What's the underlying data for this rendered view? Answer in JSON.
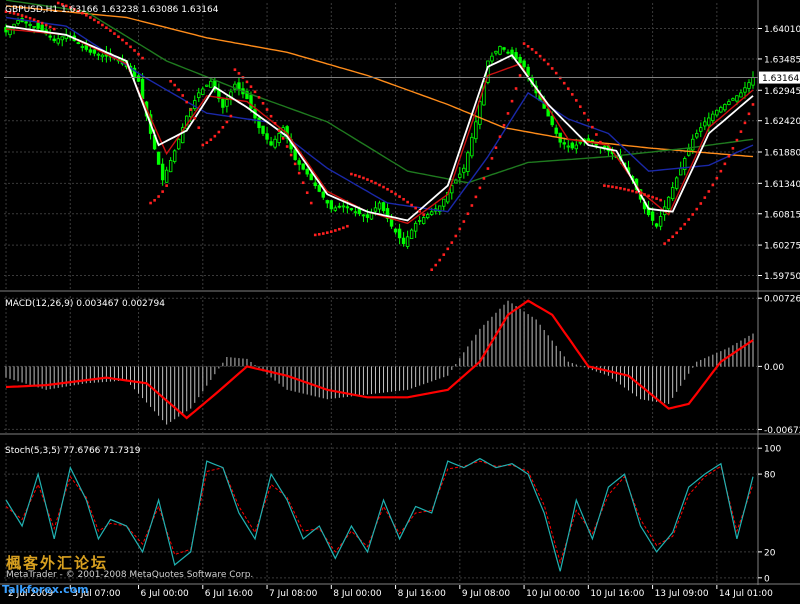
{
  "chart_data": [
    {
      "type": "candlestick",
      "title": "GBPUSD,H1  1.63166 1.63238 1.63086 1.63164",
      "ylim": [
        1.595,
        1.6445
      ],
      "y_ticks": [
        "1.64010",
        "1.63485",
        "1.62945",
        "1.62420",
        "1.61880",
        "1.61340",
        "1.60815",
        "1.60275",
        "1.59750"
      ],
      "y_tick_values": [
        1.6401,
        1.63485,
        1.62945,
        1.6242,
        1.6188,
        1.6134,
        1.60815,
        1.60275,
        1.5975
      ],
      "current_price_label": "1.63164",
      "current_price": 1.63164,
      "x_labels": [
        "2 Jul 2009",
        "3 Jul 07:00",
        "6 Jul 00:00",
        "6 Jul 16:00",
        "7 Jul 08:00",
        "8 Jul 00:00",
        "8 Jul 16:00",
        "9 Jul 08:00",
        "10 Jul 00:00",
        "10 Jul 16:00",
        "13 Jul 09:00",
        "14 Jul 01:00"
      ],
      "x_label_bars": [
        0,
        16,
        33,
        49,
        65,
        81,
        97,
        113,
        129,
        145,
        161,
        177
      ],
      "bar_count": 187,
      "close_anchors": [
        [
          0,
          1.6395
        ],
        [
          3,
          1.6415
        ],
        [
          6,
          1.6408
        ],
        [
          9,
          1.6398
        ],
        [
          12,
          1.638
        ],
        [
          15,
          1.639
        ],
        [
          18,
          1.6375
        ],
        [
          21,
          1.636
        ],
        [
          24,
          1.6355
        ],
        [
          27,
          1.635
        ],
        [
          30,
          1.6335
        ],
        [
          33,
          1.631
        ],
        [
          36,
          1.622
        ],
        [
          39,
          1.614
        ],
        [
          42,
          1.619
        ],
        [
          45,
          1.625
        ],
        [
          48,
          1.629
        ],
        [
          51,
          1.631
        ],
        [
          54,
          1.6265
        ],
        [
          57,
          1.6305
        ],
        [
          60,
          1.628
        ],
        [
          63,
          1.623
        ],
        [
          66,
          1.62
        ],
        [
          69,
          1.623
        ],
        [
          72,
          1.6175
        ],
        [
          75,
          1.615
        ],
        [
          78,
          1.612
        ],
        [
          81,
          1.609
        ],
        [
          84,
          1.6095
        ],
        [
          87,
          1.6085
        ],
        [
          90,
          1.6075
        ],
        [
          93,
          1.61
        ],
        [
          96,
          1.606
        ],
        [
          99,
          1.603
        ],
        [
          102,
          1.6065
        ],
        [
          105,
          1.608
        ],
        [
          108,
          1.6095
        ],
        [
          111,
          1.613
        ],
        [
          114,
          1.616
        ],
        [
          117,
          1.624
        ],
        [
          120,
          1.6345
        ],
        [
          123,
          1.637
        ],
        [
          126,
          1.6355
        ],
        [
          129,
          1.6335
        ],
        [
          132,
          1.629
        ],
        [
          135,
          1.625
        ],
        [
          138,
          1.6205
        ],
        [
          141,
          1.6195
        ],
        [
          144,
          1.621
        ],
        [
          147,
          1.62
        ],
        [
          150,
          1.619
        ],
        [
          153,
          1.6175
        ],
        [
          156,
          1.614
        ],
        [
          159,
          1.609
        ],
        [
          162,
          1.606
        ],
        [
          165,
          1.611
        ],
        [
          168,
          1.616
        ],
        [
          171,
          1.621
        ],
        [
          174,
          1.624
        ],
        [
          177,
          1.626
        ],
        [
          180,
          1.6275
        ],
        [
          183,
          1.629
        ],
        [
          186,
          1.63164
        ]
      ],
      "moving_averages": [
        {
          "color": "#ff8c1a",
          "anchors": [
            [
              0,
              1.644
            ],
            [
              30,
              1.642
            ],
            [
              50,
              1.6385
            ],
            [
              70,
              1.636
            ],
            [
              90,
              1.632
            ],
            [
              110,
              1.627
            ],
            [
              124,
              1.623
            ],
            [
              140,
              1.621
            ],
            [
              160,
              1.6195
            ],
            [
              186,
              1.618
            ]
          ]
        },
        {
          "color": "#1f7a1f",
          "anchors": [
            [
              0,
              1.645
            ],
            [
              20,
              1.643
            ],
            [
              40,
              1.6345
            ],
            [
              60,
              1.629
            ],
            [
              80,
              1.624
            ],
            [
              100,
              1.6155
            ],
            [
              115,
              1.6135
            ],
            [
              130,
              1.617
            ],
            [
              150,
              1.618
            ],
            [
              170,
              1.6195
            ],
            [
              186,
              1.621
            ]
          ]
        },
        {
          "color": "#1a28a8",
          "anchors": [
            [
              0,
              1.642
            ],
            [
              15,
              1.6405
            ],
            [
              35,
              1.6315
            ],
            [
              50,
              1.6255
            ],
            [
              65,
              1.624
            ],
            [
              80,
              1.616
            ],
            [
              95,
              1.61
            ],
            [
              110,
              1.6085
            ],
            [
              120,
              1.618
            ],
            [
              130,
              1.629
            ],
            [
              140,
              1.6245
            ],
            [
              150,
              1.622
            ],
            [
              160,
              1.6155
            ],
            [
              175,
              1.6165
            ],
            [
              186,
              1.62
            ]
          ]
        },
        {
          "color": "#cc1111",
          "anchors": [
            [
              0,
              1.64
            ],
            [
              15,
              1.639
            ],
            [
              30,
              1.634
            ],
            [
              40,
              1.6185
            ],
            [
              50,
              1.6285
            ],
            [
              60,
              1.6275
            ],
            [
              70,
              1.622
            ],
            [
              80,
              1.612
            ],
            [
              90,
              1.6085
            ],
            [
              100,
              1.6065
            ],
            [
              110,
              1.6115
            ],
            [
              120,
              1.632
            ],
            [
              128,
              1.634
            ],
            [
              140,
              1.621
            ],
            [
              150,
              1.62
            ],
            [
              158,
              1.612
            ],
            [
              165,
              1.608
            ],
            [
              175,
              1.623
            ],
            [
              186,
              1.6295
            ]
          ]
        },
        {
          "color": "#ffffff",
          "anchors": [
            [
              0,
              1.6405
            ],
            [
              15,
              1.639
            ],
            [
              30,
              1.6345
            ],
            [
              38,
              1.62
            ],
            [
              45,
              1.6225
            ],
            [
              52,
              1.63
            ],
            [
              60,
              1.6265
            ],
            [
              70,
              1.6215
            ],
            [
              80,
              1.6115
            ],
            [
              90,
              1.6085
            ],
            [
              100,
              1.607
            ],
            [
              110,
              1.613
            ],
            [
              120,
              1.6335
            ],
            [
              126,
              1.6355
            ],
            [
              135,
              1.627
            ],
            [
              145,
              1.62
            ],
            [
              152,
              1.619
            ],
            [
              160,
              1.609
            ],
            [
              166,
              1.6085
            ],
            [
              175,
              1.622
            ],
            [
              186,
              1.6285
            ]
          ]
        }
      ],
      "parabolic_sar_segments": [
        {
          "from": 0,
          "to": 12,
          "start": 1.643,
          "end": 1.64
        },
        {
          "from": 13,
          "to": 34,
          "start": 1.6445,
          "end": 1.635
        },
        {
          "from": 36,
          "to": 40,
          "start": 1.61,
          "end": 1.613
        },
        {
          "from": 41,
          "to": 48,
          "start": 1.631,
          "end": 1.623
        },
        {
          "from": 49,
          "to": 56,
          "start": 1.62,
          "end": 1.625
        },
        {
          "from": 57,
          "to": 76,
          "start": 1.633,
          "end": 1.61
        },
        {
          "from": 77,
          "to": 85,
          "start": 1.6045,
          "end": 1.606
        },
        {
          "from": 86,
          "to": 104,
          "start": 1.615,
          "end": 1.608
        },
        {
          "from": 106,
          "to": 128,
          "start": 1.5985,
          "end": 1.632
        },
        {
          "from": 129,
          "to": 148,
          "start": 1.6375,
          "end": 1.6205
        },
        {
          "from": 149,
          "to": 163,
          "start": 1.613,
          "end": 1.6105
        },
        {
          "from": 164,
          "to": 186,
          "start": 1.603,
          "end": 1.627
        }
      ],
      "colors": {
        "up_bar": "#00ff00",
        "down_bar": "#00ff00",
        "grid": "#3a3a3a",
        "sar": "#ff2020"
      }
    },
    {
      "type": "macd",
      "title": "MACD(12,26,9) 0.003467 0.002794",
      "ylim": [
        -0.0071,
        0.0075
      ],
      "y_ticks": [
        "0.007266",
        "0.00",
        "-0.00672"
      ],
      "y_tick_values": [
        0.007266,
        0.0,
        -0.00672
      ],
      "histogram_anchors": [
        [
          0,
          -0.0012
        ],
        [
          10,
          -0.0025
        ],
        [
          20,
          -0.0018
        ],
        [
          30,
          -0.0015
        ],
        [
          40,
          -0.0062
        ],
        [
          46,
          -0.0045
        ],
        [
          55,
          0.001
        ],
        [
          60,
          0.0008
        ],
        [
          70,
          -0.0025
        ],
        [
          80,
          -0.0035
        ],
        [
          90,
          -0.003
        ],
        [
          100,
          -0.0025
        ],
        [
          110,
          -0.001
        ],
        [
          118,
          0.004
        ],
        [
          125,
          0.007
        ],
        [
          132,
          0.005
        ],
        [
          140,
          0.0005
        ],
        [
          150,
          -0.001
        ],
        [
          158,
          -0.0035
        ],
        [
          165,
          -0.004
        ],
        [
          172,
          0.0005
        ],
        [
          180,
          0.002
        ],
        [
          186,
          0.0035
        ]
      ],
      "signal_anchors": [
        [
          0,
          -0.0022
        ],
        [
          10,
          -0.002
        ],
        [
          25,
          -0.0012
        ],
        [
          35,
          -0.0018
        ],
        [
          45,
          -0.0055
        ],
        [
          52,
          -0.003
        ],
        [
          60,
          0.0
        ],
        [
          70,
          -0.001
        ],
        [
          80,
          -0.0025
        ],
        [
          90,
          -0.0033
        ],
        [
          100,
          -0.0033
        ],
        [
          110,
          -0.0025
        ],
        [
          118,
          0.0005
        ],
        [
          125,
          0.0055
        ],
        [
          130,
          0.007
        ],
        [
          136,
          0.0055
        ],
        [
          145,
          0.0
        ],
        [
          155,
          -0.001
        ],
        [
          165,
          -0.0045
        ],
        [
          170,
          -0.004
        ],
        [
          178,
          0.0005
        ],
        [
          186,
          0.0028
        ]
      ],
      "colors": {
        "histogram": "#c0c0c0",
        "signal": "#ff0000"
      }
    },
    {
      "type": "stochastic",
      "title": "Stoch(5,3,5) 77.6766 71.7319",
      "ylim": [
        0,
        100
      ],
      "y_ticks": [
        "100",
        "80",
        "20",
        "0"
      ],
      "y_tick_values": [
        100,
        80,
        20,
        0
      ],
      "main_anchors": [
        [
          0,
          60
        ],
        [
          4,
          40
        ],
        [
          8,
          80
        ],
        [
          12,
          30
        ],
        [
          16,
          85
        ],
        [
          20,
          60
        ],
        [
          23,
          30
        ],
        [
          26,
          45
        ],
        [
          30,
          40
        ],
        [
          34,
          20
        ],
        [
          38,
          60
        ],
        [
          42,
          10
        ],
        [
          46,
          20
        ],
        [
          50,
          90
        ],
        [
          54,
          85
        ],
        [
          58,
          50
        ],
        [
          62,
          30
        ],
        [
          66,
          80
        ],
        [
          70,
          60
        ],
        [
          74,
          30
        ],
        [
          78,
          40
        ],
        [
          82,
          15
        ],
        [
          86,
          40
        ],
        [
          90,
          20
        ],
        [
          94,
          60
        ],
        [
          98,
          30
        ],
        [
          102,
          55
        ],
        [
          106,
          50
        ],
        [
          110,
          90
        ],
        [
          114,
          85
        ],
        [
          118,
          92
        ],
        [
          122,
          85
        ],
        [
          126,
          88
        ],
        [
          130,
          80
        ],
        [
          134,
          50
        ],
        [
          138,
          5
        ],
        [
          142,
          60
        ],
        [
          146,
          30
        ],
        [
          150,
          70
        ],
        [
          154,
          80
        ],
        [
          158,
          40
        ],
        [
          162,
          20
        ],
        [
          166,
          35
        ],
        [
          170,
          70
        ],
        [
          174,
          80
        ],
        [
          178,
          88
        ],
        [
          182,
          30
        ],
        [
          186,
          78
        ]
      ],
      "signal_anchors": [
        [
          0,
          55
        ],
        [
          4,
          45
        ],
        [
          8,
          72
        ],
        [
          12,
          38
        ],
        [
          16,
          78
        ],
        [
          20,
          62
        ],
        [
          23,
          36
        ],
        [
          26,
          42
        ],
        [
          30,
          40
        ],
        [
          34,
          26
        ],
        [
          38,
          55
        ],
        [
          42,
          18
        ],
        [
          46,
          22
        ],
        [
          50,
          82
        ],
        [
          54,
          85
        ],
        [
          58,
          55
        ],
        [
          62,
          35
        ],
        [
          66,
          72
        ],
        [
          70,
          62
        ],
        [
          74,
          36
        ],
        [
          78,
          38
        ],
        [
          82,
          20
        ],
        [
          86,
          36
        ],
        [
          90,
          24
        ],
        [
          94,
          55
        ],
        [
          98,
          34
        ],
        [
          102,
          50
        ],
        [
          106,
          52
        ],
        [
          110,
          84
        ],
        [
          114,
          86
        ],
        [
          118,
          90
        ],
        [
          122,
          86
        ],
        [
          126,
          87
        ],
        [
          130,
          82
        ],
        [
          134,
          56
        ],
        [
          138,
          12
        ],
        [
          142,
          52
        ],
        [
          146,
          34
        ],
        [
          150,
          64
        ],
        [
          154,
          78
        ],
        [
          158,
          45
        ],
        [
          162,
          25
        ],
        [
          166,
          32
        ],
        [
          170,
          64
        ],
        [
          174,
          78
        ],
        [
          178,
          86
        ],
        [
          182,
          36
        ],
        [
          186,
          72
        ]
      ],
      "colors": {
        "main": "#20b2b2",
        "signal": "#ff0000"
      }
    }
  ],
  "watermark": {
    "copyright": "MetaTrader - © 2001-2008 MetaQuotes Software Corp.",
    "site": "Talkforex.com",
    "chinese": "楓客外汇论坛"
  }
}
